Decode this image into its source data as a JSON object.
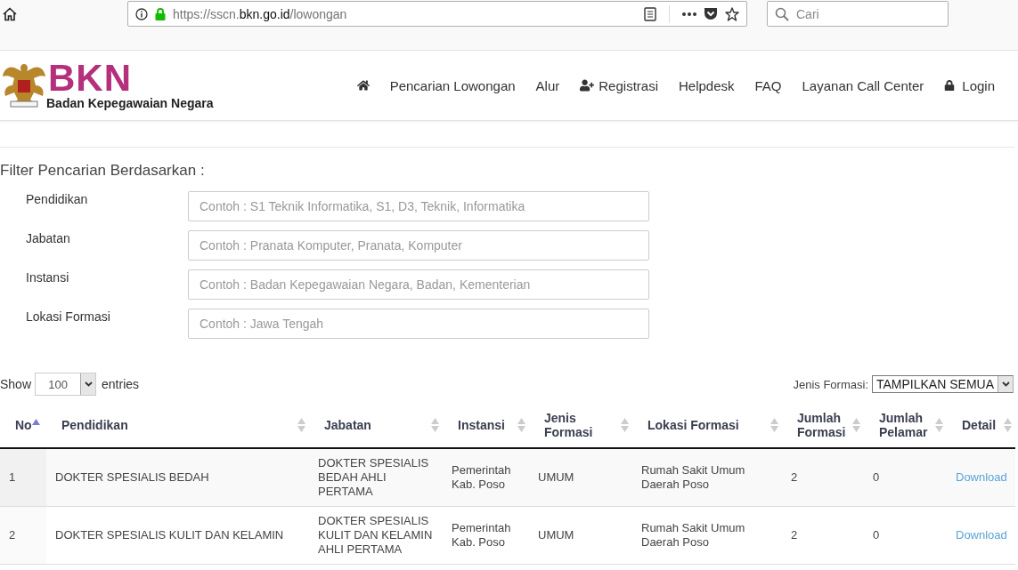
{
  "browser": {
    "url": "https://sscn.**bkn.go.id**/lowongan",
    "search": {
      "placeholder": "Cari"
    }
  },
  "header": {
    "logo_text": "BKN",
    "logo_subtitle": "Badan Kepegawaian Negara",
    "nav": [
      {
        "kind": "home"
      },
      {
        "kind": "text",
        "label": "Pencarian Lowongan"
      },
      {
        "kind": "text",
        "label": "Alur"
      },
      {
        "kind": "register",
        "label": "Registrasi"
      },
      {
        "kind": "text",
        "label": "Helpdesk"
      },
      {
        "kind": "text",
        "label": "FAQ"
      },
      {
        "kind": "text",
        "label": "Layanan Call Center"
      },
      {
        "kind": "login",
        "label": "Login"
      }
    ]
  },
  "filter": {
    "title": "Filter Pencarian Berdasarkan :",
    "fields": [
      {
        "label": "Pendidikan",
        "placeholder": "Contoh : S1 Teknik Informatika, S1, D3, Teknik, Informatika"
      },
      {
        "label": "Jabatan",
        "placeholder": "Contoh : Pranata Komputer, Pranata, Komputer"
      },
      {
        "label": "Instansi",
        "placeholder": "Contoh : Badan Kepegawaian Negara, Badan, Kementerian"
      },
      {
        "label": "Lokasi Formasi",
        "placeholder": "Contoh : Jawa Tengah"
      }
    ]
  },
  "table_controls": {
    "show_label": "Show",
    "page_size": "100",
    "entries_label": "entries",
    "type_label": "Jenis Formasi:",
    "type_value": "TAMPILKAN SEMUA"
  },
  "table": {
    "columns": [
      {
        "label": "No",
        "sorted": true
      },
      {
        "label": "Pendidikan",
        "sorted": false
      },
      {
        "label": "Jabatan",
        "sorted": false
      },
      {
        "label": "Instansi",
        "sorted": false
      },
      {
        "label": "Jenis Formasi",
        "sorted": false
      },
      {
        "label": "Lokasi Formasi",
        "sorted": false
      },
      {
        "label": "Jumlah Formasi",
        "sorted": false
      },
      {
        "label": "Jumlah Pelamar",
        "sorted": false
      },
      {
        "label": "Detail",
        "sorted": false
      }
    ],
    "rows": [
      {
        "cells": [
          "1",
          "DOKTER SPESIALIS BEDAH",
          "DOKTER SPESIALIS BEDAH AHLI PERTAMA",
          "Pemerintah Kab. Poso",
          "UMUM",
          "Rumah Sakit Umum Daerah Poso",
          "2",
          "0"
        ],
        "link": "Download"
      },
      {
        "cells": [
          "2",
          "DOKTER SPESIALIS KULIT DAN KELAMIN",
          "DOKTER SPESIALIS KULIT DAN KELAMIN AHLI PERTAMA",
          "Pemerintah Kab. Poso",
          "UMUM",
          "Rumah Sakit Umum Daerah Poso",
          "2",
          "0"
        ],
        "link": "Download"
      }
    ]
  }
}
